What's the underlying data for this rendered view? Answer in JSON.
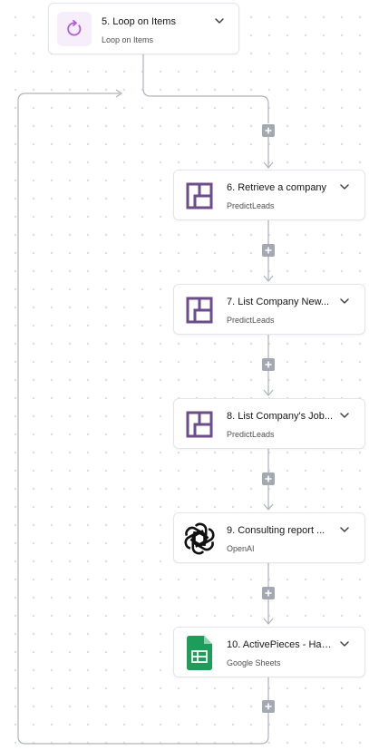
{
  "steps": [
    {
      "title": "5. Loop on Items",
      "subtitle": "Loop on Items",
      "icon": "loop-icon"
    },
    {
      "title": "6. Retrieve a company",
      "subtitle": "PredictLeads",
      "icon": "predictleads-logo-icon"
    },
    {
      "title": "7. List Company New...",
      "subtitle": "PredictLeads",
      "icon": "predictleads-logo-icon"
    },
    {
      "title": "8. List Company's Job...",
      "subtitle": "PredictLeads",
      "icon": "predictleads-logo-icon"
    },
    {
      "title": "9. Consulting report ...",
      "subtitle": "OpenAI",
      "icon": "openai-logo-icon"
    },
    {
      "title": "10. ActivePieces - Hac...",
      "subtitle": "Google Sheets",
      "icon": "google-sheets-icon"
    }
  ],
  "colors": {
    "loop_accent": "#b05ad8",
    "loop_bg": "#f7eefc",
    "predictleads": "#6b4c8c",
    "sheets_green": "#1e9d5a",
    "connector": "#aeb3bc",
    "add_button": "#a3a8b3"
  }
}
